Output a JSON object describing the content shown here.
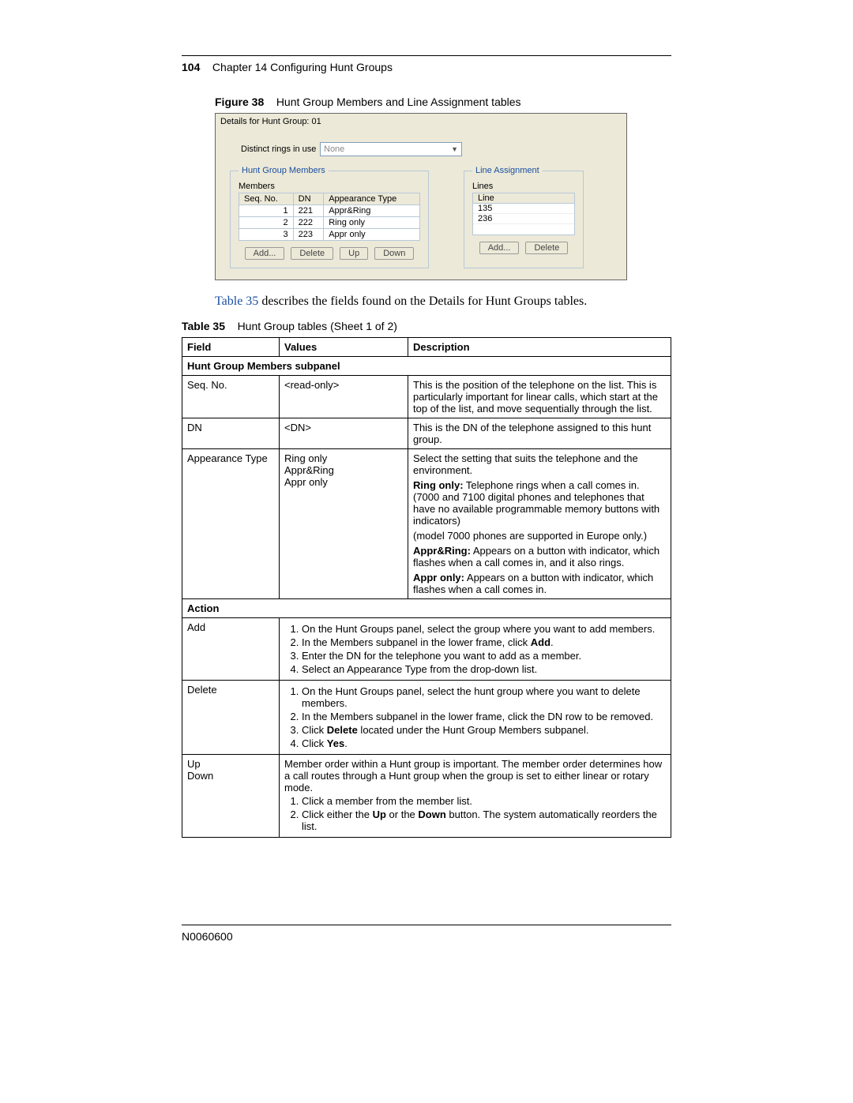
{
  "header": {
    "page_number": "104",
    "chapter": "Chapter 14  Configuring Hunt Groups"
  },
  "figure": {
    "label": "Figure 38",
    "caption": "Hunt Group Members and Line Assignment tables"
  },
  "screenshot": {
    "title": "Details for Hunt Group: 01",
    "distinct_label": "Distinct rings in use",
    "distinct_value": "None",
    "members_legend": "Hunt Group Members",
    "members_label": "Members",
    "members_headers": [
      "Seq. No.",
      "DN",
      "Appearance Type"
    ],
    "members_rows": [
      [
        "1",
        "221",
        "Appr&Ring"
      ],
      [
        "2",
        "222",
        "Ring only"
      ],
      [
        "3",
        "223",
        "Appr only"
      ]
    ],
    "members_buttons": [
      "Add...",
      "Delete",
      "Up",
      "Down"
    ],
    "lines_legend": "Line Assignment",
    "lines_label": "Lines",
    "lines_header": "Line",
    "lines_rows": [
      "135",
      "236"
    ],
    "lines_buttons": [
      "Add...",
      "Delete"
    ]
  },
  "prose": {
    "link_text": "Table 35",
    "rest": " describes the fields found on the Details for Hunt Groups tables."
  },
  "tablecap": {
    "label": "Table 35",
    "caption": "Hunt Group tables (Sheet 1 of 2)"
  },
  "doc_table": {
    "headers": [
      "Field",
      "Values",
      "Description"
    ],
    "section1": "Hunt Group Members subpanel",
    "row_seq": {
      "field": "Seq. No.",
      "values": "<read-only>",
      "desc": "This is the position of the telephone on the list. This is particularly important for linear calls, which start at the top of the list, and move sequentially through the list."
    },
    "row_dn": {
      "field": "DN",
      "values": "<DN>",
      "desc": "This is the DN of the telephone assigned to this hunt group."
    },
    "row_app": {
      "field": "Appearance Type",
      "values_lines": [
        "Ring only",
        "Appr&Ring",
        "Appr only"
      ],
      "desc1": "Select the setting that suits the telephone and the environment.",
      "desc2a_bold": "Ring only:",
      "desc2a_rest": " Telephone rings when a call comes in. (7000 and 7100 digital phones and telephones that have no available programmable memory buttons with indicators)",
      "desc2b": "(model 7000 phones are supported in Europe only.)",
      "desc3_bold": "Appr&Ring:",
      "desc3_rest": " Appears on a button with indicator, which flashes when a call comes in, and it also rings.",
      "desc4_bold": "Appr only:",
      "desc4_rest": " Appears on a button with indicator, which flashes when a call comes in."
    },
    "section2": "Action",
    "row_add": {
      "field": "Add",
      "s1": "On the Hunt Groups panel, select the group where you want to add members.",
      "s2a": "In the Members subpanel in the lower frame, click ",
      "s2b_bold": "Add",
      "s2c": ".",
      "s3": "Enter the DN for the telephone you want to add as a member.",
      "s4": "Select an Appearance Type from the drop-down list."
    },
    "row_del": {
      "field": "Delete",
      "s1": "On the Hunt Groups panel, select the hunt group where you want to delete members.",
      "s2": "In the Members subpanel in the lower frame, click the DN row to be removed.",
      "s3a": "Click ",
      "s3b_bold": "Delete",
      "s3c": " located under the Hunt Group Members subpanel.",
      "s4a": "Click ",
      "s4b_bold": "Yes",
      "s4c": "."
    },
    "row_updown": {
      "field1": "Up",
      "field2": "Down",
      "intro": "Member order within a Hunt group is important. The member order determines how a call routes through a Hunt group when the group is set to either linear or rotary mode.",
      "s1": "Click a member from the member list.",
      "s2a": "Click either the ",
      "s2b_bold": "Up",
      "s2c": " or the ",
      "s2d_bold": "Down",
      "s2e": " button. The system automatically reorders the list."
    }
  },
  "footer": {
    "docnum": "N0060600"
  }
}
